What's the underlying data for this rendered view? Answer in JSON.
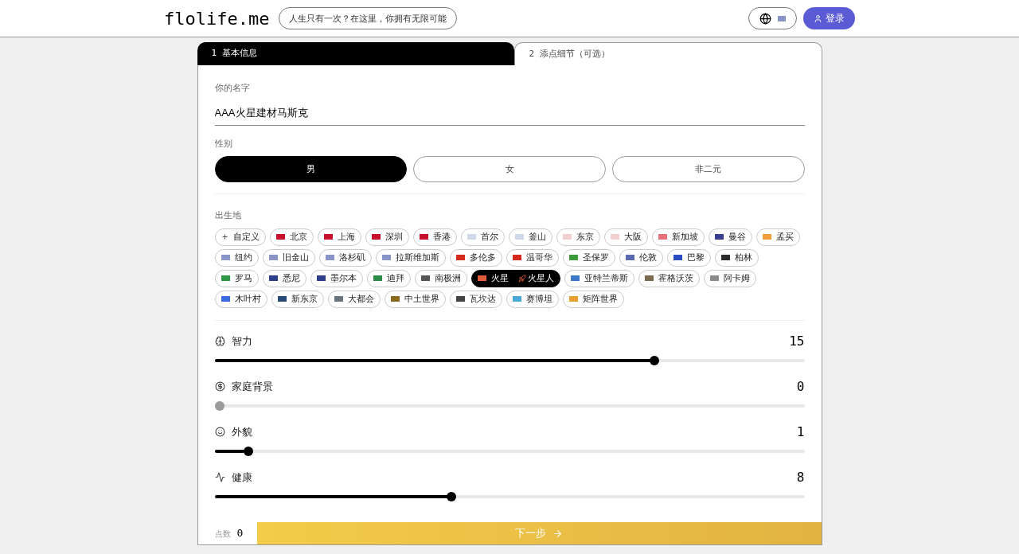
{
  "header": {
    "logo": "flolife.me",
    "tagline": "人生只有一次？在这里，你拥有无限可能",
    "login": "登录"
  },
  "tabs": [
    {
      "label": "1 基本信息",
      "selected": true
    },
    {
      "label": "2 添点细节（可选）",
      "selected": false
    }
  ],
  "name_field": {
    "label": "你的名字",
    "value": "AAA火星建材马斯克"
  },
  "gender": {
    "label": "性别",
    "options": [
      {
        "label": "男",
        "selected": true
      },
      {
        "label": "女",
        "selected": false
      },
      {
        "label": "非二元",
        "selected": false
      }
    ]
  },
  "birthplace": {
    "label": "出生地",
    "places": [
      {
        "kind": "custom",
        "label": "自定义",
        "selected": false
      },
      {
        "kind": "place",
        "label": "北京",
        "color": "#c8102e",
        "selected": false
      },
      {
        "kind": "place",
        "label": "上海",
        "color": "#c8102e",
        "selected": false
      },
      {
        "kind": "place",
        "label": "深圳",
        "color": "#c8102e",
        "selected": false
      },
      {
        "kind": "place",
        "label": "香港",
        "color": "#c8102e",
        "selected": false
      },
      {
        "kind": "place",
        "label": "首尔",
        "color": "#cfd8e8",
        "selected": false
      },
      {
        "kind": "place",
        "label": "釜山",
        "color": "#cfd8e8",
        "selected": false
      },
      {
        "kind": "place",
        "label": "东京",
        "color": "#f2d0d0",
        "selected": false
      },
      {
        "kind": "place",
        "label": "大阪",
        "color": "#f2d0d0",
        "selected": false
      },
      {
        "kind": "place",
        "label": "新加坡",
        "color": "#e8707a",
        "selected": false
      },
      {
        "kind": "place",
        "label": "曼谷",
        "color": "#3a3f8f",
        "selected": false
      },
      {
        "kind": "place",
        "label": "孟买",
        "color": "#f39c3a",
        "selected": false
      },
      {
        "kind": "place",
        "label": "纽约",
        "color": "#8a93c6",
        "selected": false
      },
      {
        "kind": "place",
        "label": "旧金山",
        "color": "#8a93c6",
        "selected": false
      },
      {
        "kind": "place",
        "label": "洛杉矶",
        "color": "#8a93c6",
        "selected": false
      },
      {
        "kind": "place",
        "label": "拉斯维加斯",
        "color": "#8a93c6",
        "selected": false
      },
      {
        "kind": "place",
        "label": "多伦多",
        "color": "#d52b1e",
        "selected": false
      },
      {
        "kind": "place",
        "label": "温哥华",
        "color": "#d52b1e",
        "selected": false
      },
      {
        "kind": "place",
        "label": "圣保罗",
        "color": "#3c9a3c",
        "selected": false
      },
      {
        "kind": "place",
        "label": "伦敦",
        "color": "#5a6ab0",
        "selected": false
      },
      {
        "kind": "place",
        "label": "巴黎",
        "color": "#2c4cc0",
        "selected": false
      },
      {
        "kind": "place",
        "label": "柏林",
        "color": "#2b2b2b",
        "selected": false
      },
      {
        "kind": "place",
        "label": "罗马",
        "color": "#2e9a48",
        "selected": false
      },
      {
        "kind": "place",
        "label": "悉尼",
        "color": "#2c3e8c",
        "selected": false
      },
      {
        "kind": "place",
        "label": "墨尔本",
        "color": "#2c3e8c",
        "selected": false
      },
      {
        "kind": "place",
        "label": "迪拜",
        "color": "#2e8a48",
        "selected": false
      },
      {
        "kind": "place",
        "label": "南极洲",
        "color": "#555555",
        "selected": false
      },
      {
        "kind": "place",
        "label": "火星",
        "color": "#e25b3a",
        "selected": true,
        "extra": "火星人"
      },
      {
        "kind": "place",
        "label": "亚特兰蒂斯",
        "color": "#3a7ac8",
        "selected": false
      },
      {
        "kind": "place",
        "label": "霍格沃茨",
        "color": "#7a6a50",
        "selected": false
      },
      {
        "kind": "place",
        "label": "阿卡姆",
        "color": "#8a8a8a",
        "selected": false
      },
      {
        "kind": "place",
        "label": "木叶村",
        "color": "#3a6ae0",
        "selected": false
      },
      {
        "kind": "place",
        "label": "新东京",
        "color": "#2a4a7a",
        "selected": false
      },
      {
        "kind": "place",
        "label": "大都会",
        "color": "#6a7580",
        "selected": false
      },
      {
        "kind": "place",
        "label": "中土世界",
        "color": "#8a6a20",
        "selected": false
      },
      {
        "kind": "place",
        "label": "瓦坎达",
        "color": "#444444",
        "selected": false
      },
      {
        "kind": "place",
        "label": "赛博坦",
        "color": "#4aa8d8",
        "selected": false
      },
      {
        "kind": "place",
        "label": "矩阵世界",
        "color": "#e8a030",
        "selected": false
      }
    ]
  },
  "attributes": [
    {
      "kind": "brain",
      "label": "智力",
      "value": "15",
      "level": 0.75
    },
    {
      "kind": "coin",
      "label": "家庭背景",
      "value": "0",
      "level": 0
    },
    {
      "kind": "face",
      "label": "外貌",
      "value": "1",
      "level": 0.05
    },
    {
      "kind": "health",
      "label": "健康",
      "value": "8",
      "level": 0.4
    }
  ],
  "footer": {
    "points_label": "点数",
    "points": "0",
    "next": "下一步"
  }
}
